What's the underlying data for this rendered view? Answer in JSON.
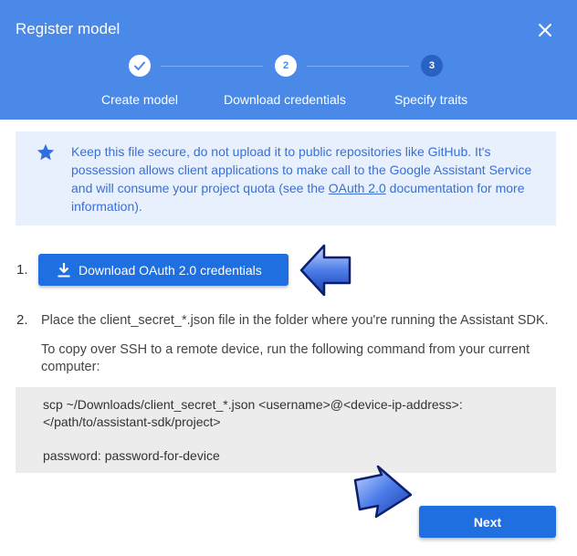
{
  "dialog": {
    "title": "Register model",
    "close_icon": "close-icon"
  },
  "stepper": {
    "steps": [
      {
        "label": "Create model",
        "state": "done",
        "marker": ""
      },
      {
        "label": "Download credentials",
        "state": "current",
        "marker": "2"
      },
      {
        "label": "Specify traits",
        "state": "todo",
        "marker": "3"
      }
    ]
  },
  "info": {
    "icon": "star-icon",
    "text_before": "Keep this file secure, do not upload it to public repositories like GitHub. It's possession allows client applications to make call to the Google Assistant Service and will consume your project quota (see the ",
    "link": "OAuth 2.0",
    "text_after": " documentation for more information)."
  },
  "step1": {
    "number": "1.",
    "button_label": "Download OAuth 2.0 credentials",
    "button_icon": "download-icon"
  },
  "step2": {
    "number": "2.",
    "instruction": "Place the client_secret_*.json file in the folder where you're running the Assistant SDK.",
    "ssh_line1": "To copy over SSH to a remote device, run the following command from your current",
    "ssh_line2": "computer:",
    "code_line1": "scp ~/Downloads/client_secret_*.json <username>@<device-ip-address>:",
    "code_line2": "</path/to/assistant-sdk/project>",
    "code_line3": "password: password-for-device"
  },
  "footer": {
    "next_label": "Next"
  },
  "colors": {
    "header": "#4a89e8",
    "button": "#1f6fe0",
    "info_bg": "#e8f0fd",
    "info_text": "#3b6fd0"
  }
}
